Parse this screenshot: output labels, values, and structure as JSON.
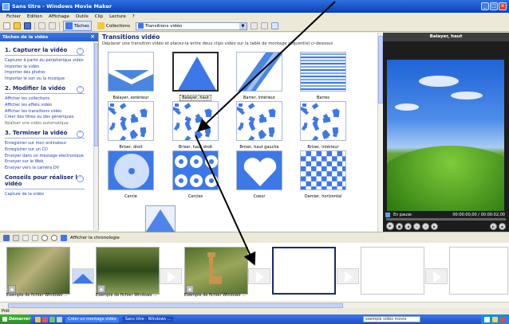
{
  "window": {
    "title": "Sans titre - Windows Movie Maker"
  },
  "menu": [
    "Fichier",
    "Edition",
    "Affichage",
    "Outils",
    "Clip",
    "Lecture",
    "?"
  ],
  "toolbar": {
    "tasks_label": "Tâches",
    "collections_label": "Collections",
    "location_value": "Transitions vidéo"
  },
  "tasks_pane": {
    "title": "Tâches de la vidéo",
    "sections": [
      {
        "title": "1. Capturer la vidéo",
        "links": [
          "Capturer à partir du périphérique vidéo",
          "Importer la vidéo",
          "Importer des photos",
          "Importer le son ou la musique"
        ]
      },
      {
        "title": "2. Modifier la vidéo",
        "links": [
          "Afficher les collections",
          "Afficher les effets vidéo",
          "Afficher les transitions vidéo",
          "Créer des titres ou des génériques",
          "Réaliser une vidéo automatique"
        ]
      },
      {
        "title": "3. Terminer la vidéo",
        "links": [
          "Enregistrer sur mon ordinateur",
          "Enregistrer sur un CD",
          "Envoyer dans un message électronique",
          "Envoyer sur le Web",
          "Envoyer vers la caméra DV"
        ]
      },
      {
        "title": "Conseils pour réaliser la vidéo",
        "links": [
          "Capture de la vidéo"
        ]
      }
    ]
  },
  "transitions": {
    "title": "Transitions vidéo",
    "subtitle": "Déplacer une transition vidéo et placez-la entre deux clips vidéo sur la table de montage séquentiel ci-dessous",
    "items": [
      {
        "label": "Balayer, extérieur",
        "style": "sweep-out"
      },
      {
        "label": "Balayer, haut",
        "style": "sweep-up",
        "selected": true
      },
      {
        "label": "Barrer, intérieur",
        "style": "diagonal"
      },
      {
        "label": "Barres",
        "style": "bars"
      },
      {
        "label": "Briser, droit",
        "style": "shatter"
      },
      {
        "label": "Briser, haut droit",
        "style": "shatter"
      },
      {
        "label": "Briser, haut gauche",
        "style": "shatter"
      },
      {
        "label": "Briser, intérieur",
        "style": "shatter"
      },
      {
        "label": "Cercle",
        "style": "circle"
      },
      {
        "label": "Cercles",
        "style": "circles"
      },
      {
        "label": "Coeur",
        "style": "heart"
      },
      {
        "label": "Damier, horizontal",
        "style": "checker"
      }
    ]
  },
  "preview": {
    "title": "Balayer, haut",
    "status": "En pause",
    "time": "00:00:00,00 / 00:00:02,00"
  },
  "storyboard": {
    "timeline_label": "Afficher la chronologie",
    "clips": [
      {
        "caption": "Exemple de fichier Windows ..."
      },
      {
        "caption": "Exemple de fichier Windows ..."
      },
      {
        "caption": "Exemple de fichier Windows ..."
      }
    ]
  },
  "statusbar": {
    "text": "Prêt"
  },
  "taskbar": {
    "start_label": "Démarrer",
    "buttons": [
      "Créer un montage vidéo",
      "Sans titre - Windows ..."
    ],
    "search_value": "exemple vidéo movie maker"
  },
  "colors": {
    "accent": "#2b6fe0",
    "link": "#2541b2",
    "preview_bg": "#1d1d1d"
  }
}
